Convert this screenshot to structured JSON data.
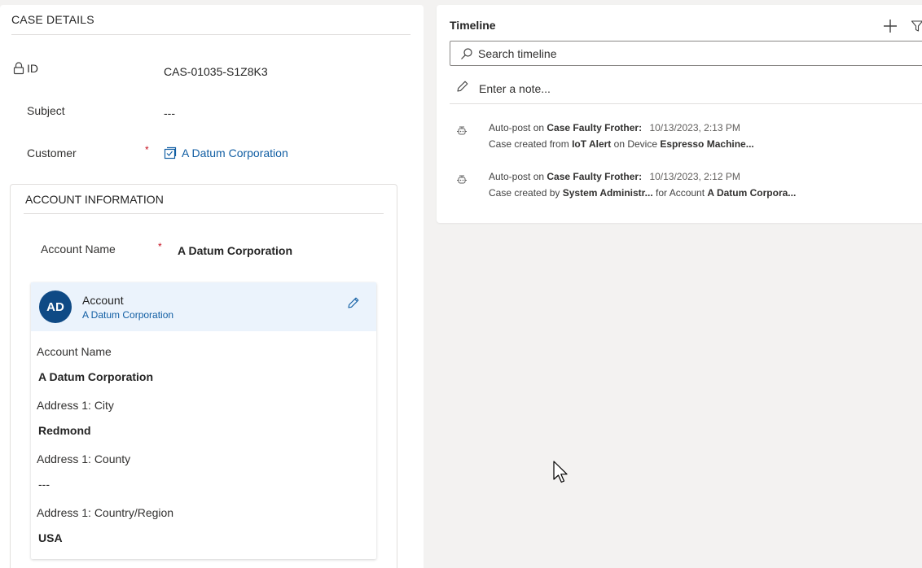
{
  "case_details": {
    "title": "CASE DETAILS",
    "id_label": "ID",
    "id_value": "CAS-01035-S1Z8K3",
    "subject_label": "Subject",
    "subject_value": "---",
    "customer_label": "Customer",
    "customer_value": "A Datum Corporation",
    "required_marker": "*"
  },
  "account_info": {
    "title": "ACCOUNT INFORMATION",
    "account_name_label": "Account Name",
    "account_name_value": "A Datum Corporation",
    "card": {
      "avatar_initials": "AD",
      "entity_type": "Account",
      "entity_name": "A Datum Corporation",
      "fields": [
        {
          "label": "Account Name",
          "value": "A Datum Corporation"
        },
        {
          "label": "Address 1: City",
          "value": "Redmond"
        },
        {
          "label": "Address 1: County",
          "value": "---"
        },
        {
          "label": "Address 1: Country/Region",
          "value": "USA"
        }
      ]
    }
  },
  "timeline": {
    "title": "Timeline",
    "search_placeholder": "Search timeline",
    "note_placeholder": "Enter a note...",
    "items": [
      {
        "prefix": "Auto-post on",
        "case_name": "Case Faulty Frother:",
        "date": "10/13/2023, 2:13 PM",
        "l2_a": "Case created from",
        "l2_b": "IoT Alert",
        "l2_c": "on Device",
        "l2_d": "Espresso Machine..."
      },
      {
        "prefix": "Auto-post on",
        "case_name": "Case Faulty Frother:",
        "date": "10/13/2023, 2:12 PM",
        "l2_a": "Case created by",
        "l2_b": "System Administr...",
        "l2_c": "for Account",
        "l2_d": "A Datum Corpora..."
      }
    ]
  },
  "icons": {
    "lock": "lock-icon",
    "lookup": "account-entity-icon",
    "edit": "pencil-icon",
    "add": "plus-icon",
    "filter": "filter-icon",
    "search": "search-icon",
    "note": "pencil-icon",
    "post": "auto-post-icon"
  },
  "colors": {
    "link": "#115ea3",
    "avatar": "#0f4a85",
    "required": "#c50f1f",
    "card_header": "#ebf3fc"
  }
}
